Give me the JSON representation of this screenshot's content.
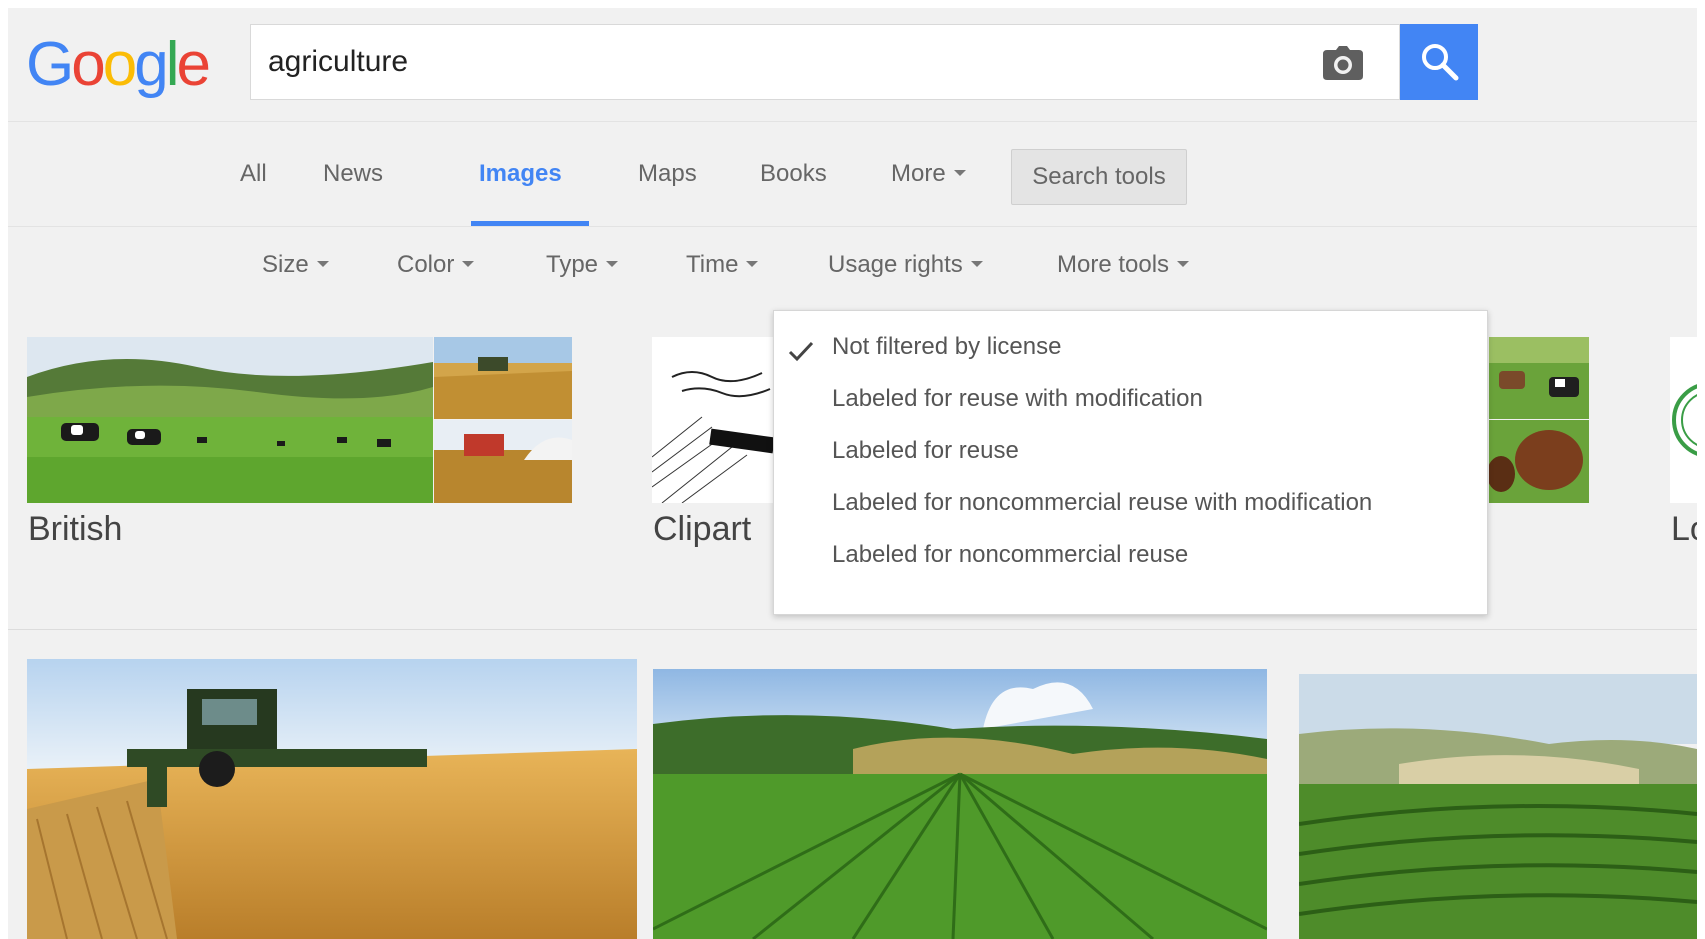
{
  "header": {
    "logo_letters": [
      "G",
      "o",
      "o",
      "g",
      "l",
      "e"
    ],
    "search_value": "agriculture",
    "camera_icon": "camera-icon",
    "search_icon": "magnifier-icon",
    "accent_color": "#4285f4"
  },
  "nav": {
    "tabs": [
      {
        "label": "All"
      },
      {
        "label": "News"
      },
      {
        "label": "Images",
        "active": true
      },
      {
        "label": "Maps"
      },
      {
        "label": "Books"
      },
      {
        "label": "More"
      }
    ],
    "search_tools_label": "Search tools"
  },
  "tools": {
    "items": [
      {
        "label": "Size"
      },
      {
        "label": "Color"
      },
      {
        "label": "Type"
      },
      {
        "label": "Time"
      },
      {
        "label": "Usage rights"
      },
      {
        "label": "More tools"
      }
    ]
  },
  "usage_menu": {
    "items": [
      {
        "label": "Not filtered by license",
        "checked": true
      },
      {
        "label": "Labeled for reuse with modification"
      },
      {
        "label": "Labeled for reuse"
      },
      {
        "label": "Labeled for noncommercial reuse with modification"
      },
      {
        "label": "Labeled for noncommercial reuse"
      }
    ]
  },
  "results": {
    "groups": [
      {
        "label": "British"
      },
      {
        "label": "Clipart"
      },
      {
        "label": "Lo"
      }
    ]
  }
}
